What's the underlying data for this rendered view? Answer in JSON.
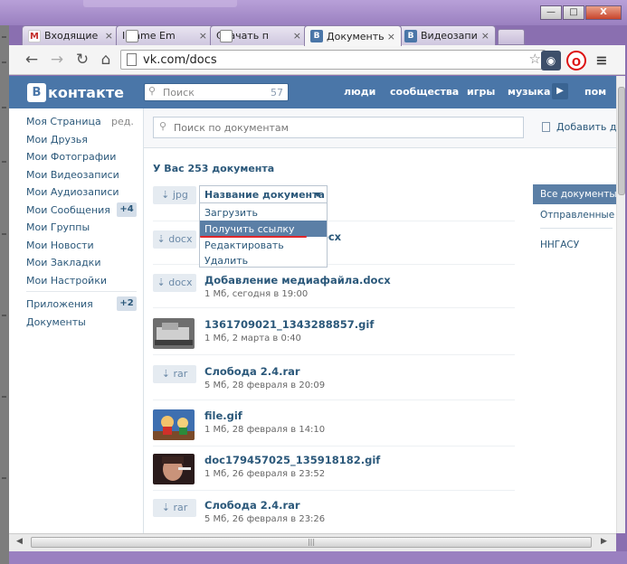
{
  "browser": {
    "tabs": [
      {
        "label": "Входящие",
        "favicon": "gmail-icon"
      },
      {
        "label": "IFrame Em",
        "favicon": "document-icon"
      },
      {
        "label": "Скачать п",
        "favicon": "document-icon"
      },
      {
        "label": "Документы",
        "favicon": "vk-icon"
      },
      {
        "label": "Видеозапи",
        "favicon": "vk-icon"
      }
    ],
    "url": "vk.com/docs",
    "window_buttons": {
      "minimize": "—",
      "maximize": "□",
      "close": "X"
    },
    "scroll_grip": "|||"
  },
  "vk": {
    "logo": "контакте",
    "logo_letter": "В",
    "search_placeholder": "Поиск",
    "search_count": "57",
    "nav": [
      "люди",
      "сообщества",
      "игры",
      "музыка",
      "пом"
    ],
    "menu": [
      {
        "label": "Моя Страница",
        "extra": "ред."
      },
      {
        "label": "Мои Друзья"
      },
      {
        "label": "Мои Фотографии"
      },
      {
        "label": "Мои Видеозаписи"
      },
      {
        "label": "Мои Аудиозаписи"
      },
      {
        "label": "Мои Сообщения",
        "badge": "+4"
      },
      {
        "label": "Мои Группы"
      },
      {
        "label": "Мои Новости"
      },
      {
        "label": "Мои Закладки"
      },
      {
        "label": "Мои Настройки"
      },
      {
        "label": "Приложения",
        "badge": "+2"
      },
      {
        "label": "Документы"
      }
    ],
    "docs_search_placeholder": "Поиск по документам",
    "add_document": "Добавить документ",
    "count_text": "У Вас 253 документа",
    "dropdown": {
      "title": "Название документа",
      "items": [
        "Загрузить",
        "Получить ссылку",
        "Редактировать",
        "Удалить"
      ],
      "highlighted_index": 1
    },
    "docs": [
      {
        "ext": "jpg",
        "name": "",
        "meta": ""
      },
      {
        "ext": "docx",
        "name": "записи.docx",
        "meta": ""
      },
      {
        "ext": "docx",
        "name": "Добавление медиафайла.docx",
        "meta": "1 Мб, сегодня в 19:00"
      },
      {
        "ext": "",
        "name": "1361709021_1343288857.gif",
        "meta": "1 Мб, 2 марта в 0:40"
      },
      {
        "ext": "rar",
        "name": "Слобода 2.4.rar",
        "meta": "5 Мб, 28 февраля в 20:09"
      },
      {
        "ext": "",
        "name": "file.gif",
        "meta": "1 Мб, 28 февраля в 14:10"
      },
      {
        "ext": "",
        "name": "doc179457025_135918182.gif",
        "meta": "1 Мб, 26 февраля в 23:52"
      },
      {
        "ext": "rar",
        "name": "Слобода 2.4.rar",
        "meta": "5 Мб, 26 февраля в 23:26"
      }
    ],
    "filters": [
      "Все документы",
      "Отправленные",
      "ННГАСУ"
    ]
  },
  "colors": {
    "vk_blue": "#4a76a8",
    "link": "#2b587a",
    "highlight": "#5b7fa6",
    "annotation_red": "#e0262a",
    "window_frame": "#9a80c0"
  }
}
